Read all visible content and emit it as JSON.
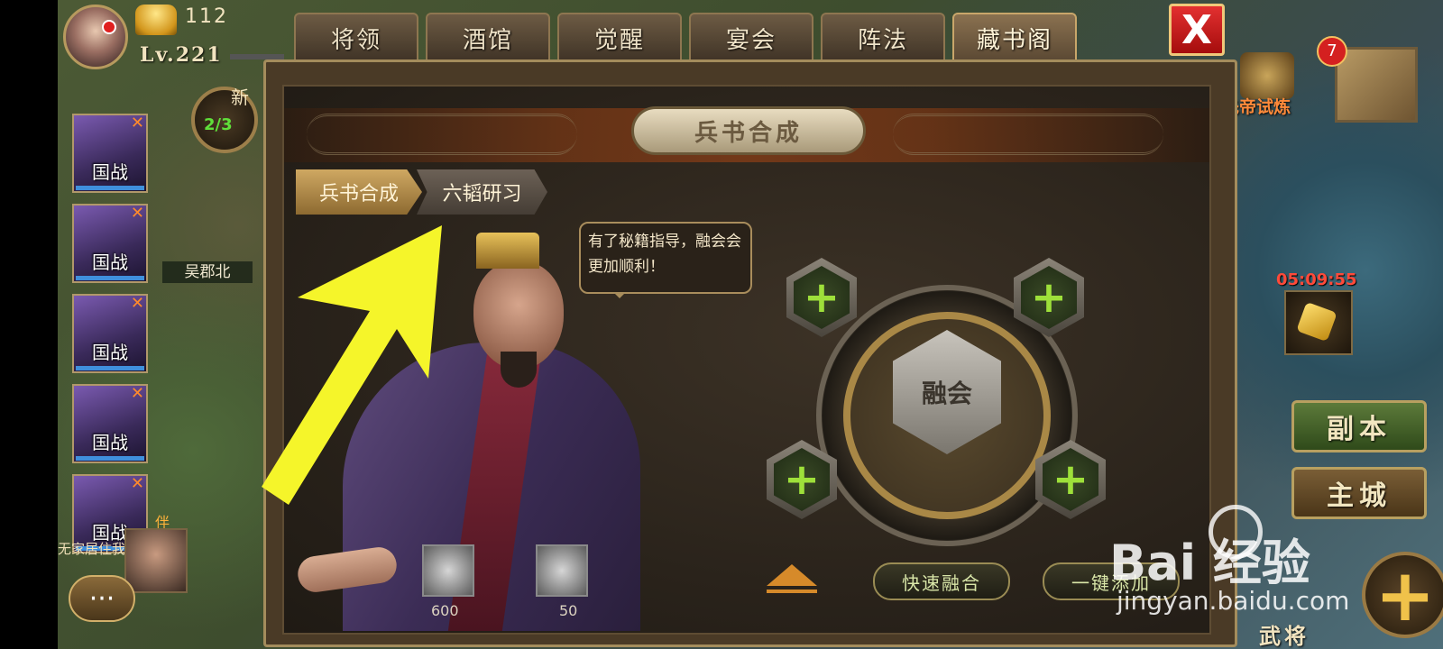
{
  "hud": {
    "gold": "112",
    "level": "Lv.221"
  },
  "tabs": [
    {
      "label": "将领",
      "active": false
    },
    {
      "label": "酒馆",
      "active": false
    },
    {
      "label": "觉醒",
      "active": false
    },
    {
      "label": "宴会",
      "active": false
    },
    {
      "label": "阵法",
      "active": false
    },
    {
      "label": "藏书阁",
      "active": true
    }
  ],
  "close_label": "X",
  "panel": {
    "title": "兵书合成",
    "subtabs": [
      "兵书合成",
      "六韬研习"
    ],
    "speech": "有了秘籍指导，融会会更加顺利！",
    "fusion_center": "融会",
    "plus_symbol": "+",
    "items": [
      {
        "icon": "silver-feather-icon",
        "count": "600"
      },
      {
        "icon": "shadow-figure-icon",
        "count": "50"
      }
    ],
    "buttons": {
      "quick_fuse": "快速融合",
      "one_click_add": "一键添加"
    }
  },
  "sidebar": {
    "cards": [
      "国战",
      "国战",
      "国战",
      "国战",
      "国战"
    ],
    "badge_new": "新",
    "badge_progress": "2/3",
    "map_label": "吴郡北",
    "ticker_partner": "伴",
    "ticker_text": "无家居住我心中",
    "chat_label": "···"
  },
  "right": {
    "notification_count": "7",
    "trial_label": "先帝试炼",
    "timer": "05:09:55",
    "dungeon_label": "副本",
    "city_label": "主城",
    "general_label": "武将",
    "add_symbol": "+"
  },
  "watermark": {
    "brand": "Bai 经验",
    "url": "jingyan.baidu.com"
  },
  "colors": {
    "accent_gold": "#c9a66a",
    "plus_green": "#9ee03a",
    "timer_red": "#ff4a3a",
    "arrow_yellow": "#f5f52a"
  }
}
